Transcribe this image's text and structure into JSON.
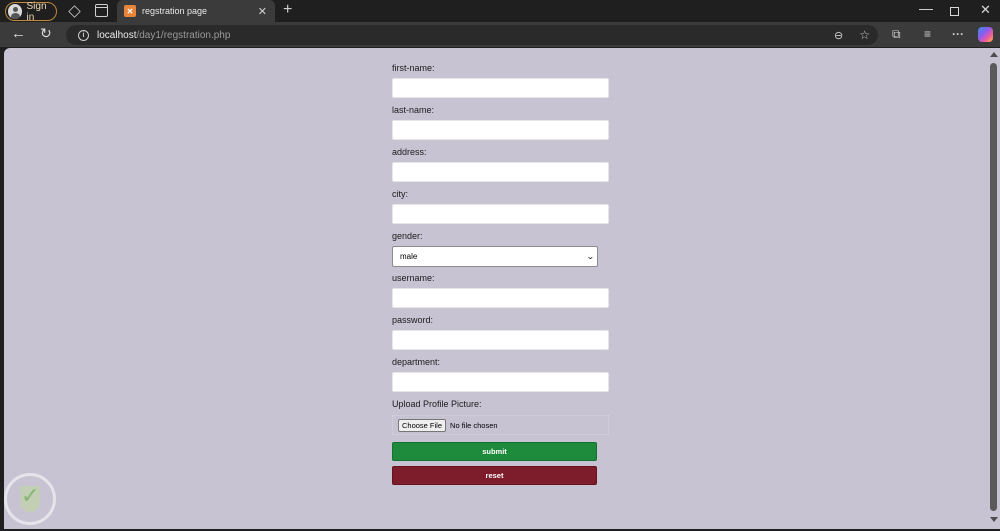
{
  "browser": {
    "signin_label": "Sign in",
    "tab_title": "regstration page",
    "url_host": "localhost",
    "url_path": "/day1/regstration.php"
  },
  "form": {
    "fields": [
      {
        "label": "first-name:"
      },
      {
        "label": "last-name:"
      },
      {
        "label": "address:"
      },
      {
        "label": "city:"
      }
    ],
    "gender": {
      "label": "gender:",
      "selected": "male"
    },
    "fields2": [
      {
        "label": "username:"
      },
      {
        "label": "password:"
      },
      {
        "label": "department:"
      }
    ],
    "upload": {
      "label": "Upload Profile Picture:",
      "button": "Choose File",
      "status": "No file chosen"
    },
    "submit_label": "submit",
    "reset_label": "reset"
  },
  "colors": {
    "page_background": "#c8c3d3",
    "submit": "#1e8a3c",
    "reset": "#7d1c2b"
  }
}
